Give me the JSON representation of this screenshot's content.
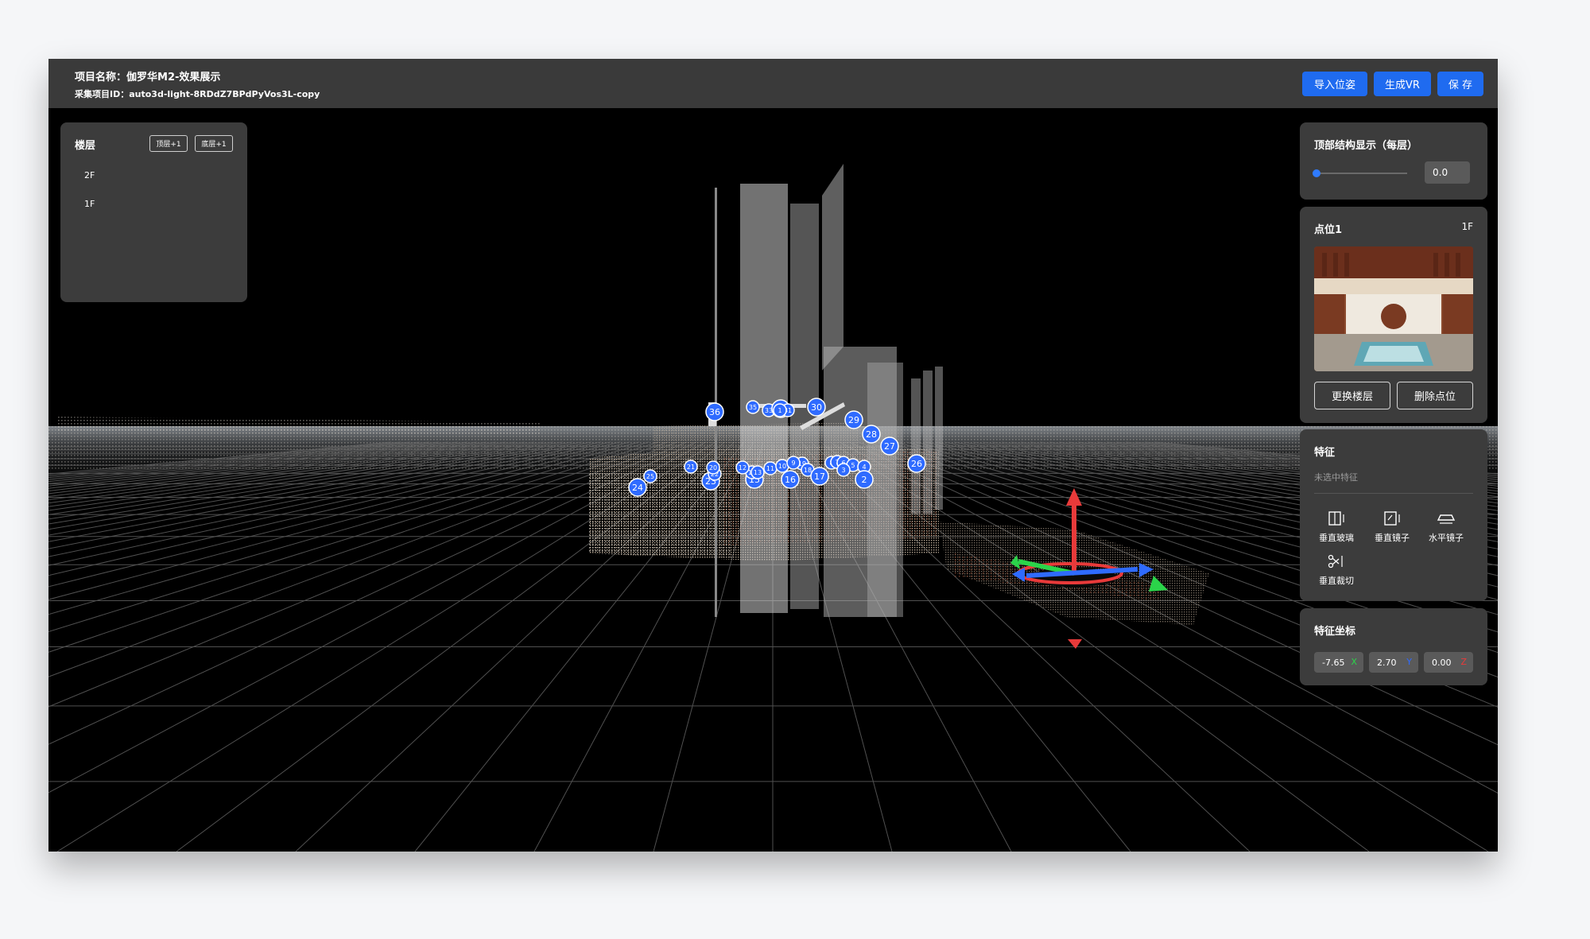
{
  "header": {
    "project_name_label": "项目名称：",
    "project_name": "伽罗华M2-效果展示",
    "collect_id_label": "采集项目ID：",
    "collect_id": "auto3d-light-8RDdZ7BPdPyVos3L-copy",
    "buttons": {
      "import_pose": "导入位姿",
      "generate_vr": "生成VR",
      "save": "保 存"
    },
    "button_color": "#1f6bf0"
  },
  "floors_panel": {
    "title": "楼层",
    "top_plus": "顶层+1",
    "bottom_plus": "底层+1",
    "floors": [
      "2F",
      "1F"
    ]
  },
  "top_structure_panel": {
    "title": "顶部结构显示（每层）",
    "value": "0.0",
    "slider_fraction": 0.0
  },
  "point_panel": {
    "title": "点位1",
    "floor": "1F",
    "change_floor": "更换楼层",
    "delete_point": "删除点位"
  },
  "features_panel": {
    "title": "特征",
    "hint": "未选中特征",
    "tools": [
      {
        "label": "垂直玻璃",
        "icon": "vertical-glass-icon"
      },
      {
        "label": "垂直镜子",
        "icon": "vertical-mirror-icon"
      },
      {
        "label": "水平镜子",
        "icon": "horizontal-mirror-icon"
      },
      {
        "label": "垂直裁切",
        "icon": "vertical-cut-icon"
      }
    ]
  },
  "coords_panel": {
    "title": "特征坐标",
    "x": "-7.65",
    "x_label": "X",
    "y": "2.70",
    "y_label": "Y",
    "z": "0.00",
    "z_label": "Z",
    "axis_colors": {
      "x": "#2bd44a",
      "y": "#2f6bff",
      "z": "#e83a3a"
    }
  },
  "viewport": {
    "point_markers": [
      "36",
      "35",
      "33",
      "32",
      "31",
      "30",
      "29",
      "28",
      "27",
      "26",
      "25",
      "24",
      "23",
      "22",
      "21",
      "20",
      "19",
      "18",
      "17",
      "16",
      "15",
      "14",
      "13",
      "12",
      "11",
      "10",
      "9",
      "8",
      "7",
      "6",
      "5",
      "4",
      "3",
      "2",
      "1"
    ],
    "marker_color": "#2f6bff"
  }
}
